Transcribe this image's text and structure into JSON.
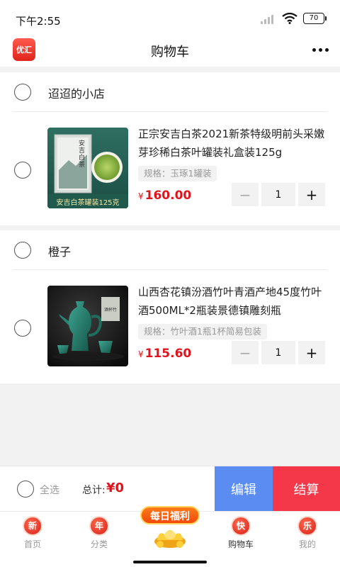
{
  "status": {
    "time": "下午2:55",
    "battery": "70"
  },
  "nav": {
    "logo_text": "优汇",
    "title": "购物车"
  },
  "shops": [
    {
      "name": "迢迢的小店",
      "item": {
        "title": "正宗安吉白茶2021新茶特级明前头采嫩芽珍稀白茶叶罐装礼盒装125g",
        "spec": "规格：玉琢1罐装",
        "currency": "¥",
        "price": "160.00",
        "quantity": "1",
        "thumb_text_top": "安吉白茶",
        "thumb_text_bottom": "安吉白茶罐装125克"
      }
    },
    {
      "name": "橙子",
      "item": {
        "title": "山西杏花镇汾酒竹叶青酒产地45度竹叶酒500ML*2瓶装景德镇雕刻瓶",
        "spec": "规格：竹叶酒1瓶1杯简易包装",
        "currency": "¥",
        "price": "115.60",
        "quantity": "1",
        "thumb_label": "酒杯竹"
      }
    }
  ],
  "checkout": {
    "select_all": "全选",
    "total_label": "总计:",
    "total_value": "¥0",
    "edit": "编辑",
    "pay": "结算"
  },
  "tabs": [
    {
      "icon_char": "新",
      "label": "首页"
    },
    {
      "icon_char": "年",
      "label": "分类"
    },
    {
      "icon_char": "快",
      "label": "购物车"
    },
    {
      "icon_char": "乐",
      "label": "我的"
    }
  ],
  "promo": {
    "text": "每日福利"
  },
  "colors": {
    "price": "#e0141c",
    "edit": "#5b8cf2",
    "pay": "#f5374a",
    "tab_icon": "#d81e18"
  },
  "icons": {
    "more": "more-dots-icon",
    "wifi": "wifi-icon",
    "signal": "signal-icon",
    "battery": "battery-icon"
  }
}
